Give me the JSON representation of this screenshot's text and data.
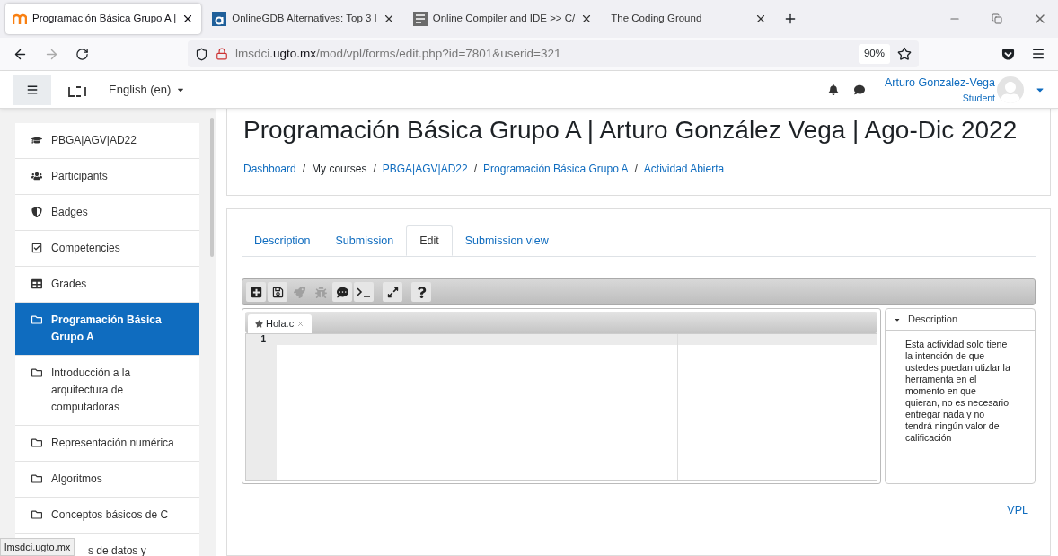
{
  "browser": {
    "tabs": [
      {
        "title": "Programación Básica Grupo A |",
        "kind": "moodle",
        "selected": true
      },
      {
        "title": "OnlineGDB Alternatives: Top 3 I",
        "kind": "a",
        "selected": false
      },
      {
        "title": "Online Compiler and IDE >> C/",
        "kind": "ide",
        "selected": false
      },
      {
        "title": "The Coding Ground",
        "kind": "plain",
        "selected": false
      }
    ],
    "address": "lmsdci.**ugto.mx**/mod/vpl/forms/edit.php?id=7801&userid=321",
    "zoom": "90%"
  },
  "navbar": {
    "language": "English (en)",
    "user_name": "Arturo Gonzalez-Vega",
    "user_role": "Student"
  },
  "sidebar": {
    "items": [
      {
        "kind": "course",
        "label": "PBGA|AGV|AD22",
        "selected": false
      },
      {
        "kind": "people",
        "label": "Participants",
        "selected": false
      },
      {
        "kind": "badge",
        "label": "Badges",
        "selected": false
      },
      {
        "kind": "check",
        "label": "Competencies",
        "selected": false
      },
      {
        "kind": "grid",
        "label": "Grades",
        "selected": false
      },
      {
        "kind": "folder",
        "label": "Programación Básica Grupo A",
        "selected": true
      },
      {
        "kind": "folder",
        "label": "Introducción a la arquitectura de computadoras",
        "selected": false
      },
      {
        "kind": "folder",
        "label": "Representación numérica",
        "selected": false
      },
      {
        "kind": "folder",
        "label": "Algoritmos",
        "selected": false
      },
      {
        "kind": "folder",
        "label": "Conceptos básicos de C",
        "selected": false
      },
      {
        "kind": "partial",
        "label": "s de datos y",
        "selected": false
      }
    ]
  },
  "status_url": "lmsdci.ugto.mx",
  "page": {
    "title": "Programación Básica Grupo A | Arturo González Vega | Ago-Dic 2022",
    "breadcrumb_separator": "/",
    "breadcrumbs": [
      {
        "label": "Dashboard",
        "link": true
      },
      {
        "label": "My courses",
        "link": false
      },
      {
        "label": "PBGA|AGV|AD22",
        "link": true
      },
      {
        "label": "Programación Básica Grupo A",
        "link": true
      },
      {
        "label": "Actividad Abierta",
        "link": true
      }
    ],
    "tabs": [
      {
        "label": "Description",
        "selected": false
      },
      {
        "label": "Submission",
        "selected": false
      },
      {
        "label": "Edit",
        "selected": true
      },
      {
        "label": "Submission view",
        "selected": false
      }
    ],
    "editor": {
      "toolbar": [
        {
          "kind": "new",
          "disabled": false
        },
        {
          "kind": "save",
          "disabled": false
        },
        {
          "kind": "run",
          "disabled": true
        },
        {
          "kind": "debug",
          "disabled": true
        },
        {
          "kind": "evaluate",
          "disabled": false
        },
        {
          "kind": "console",
          "disabled": false
        },
        {
          "kind": "fullscreen",
          "disabled": false
        },
        {
          "kind": "help",
          "disabled": false
        }
      ],
      "file_tab": "Hola.c",
      "line_numbers": [
        "1"
      ],
      "description_title": "Description",
      "description": "Esta actividad solo tiene la intención de que ustedes puedan utizlar la herramenta en el momento en que quieran, no es necesario entregar nada y no tendrá ningún valor de calificación"
    },
    "footer_link": "VPL"
  }
}
